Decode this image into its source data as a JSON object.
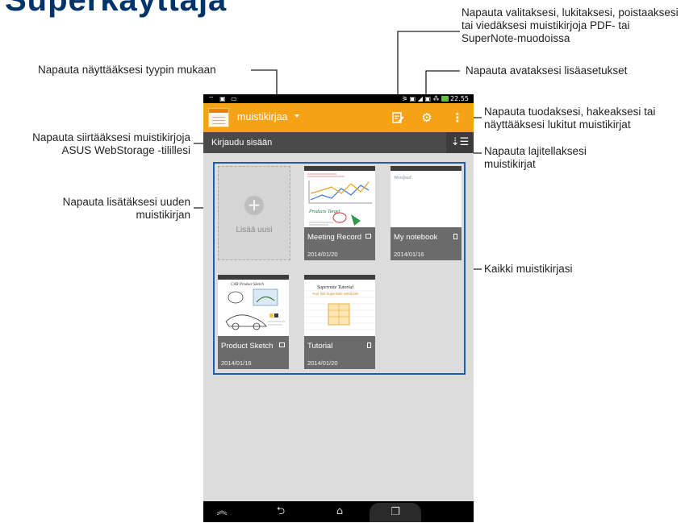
{
  "header_fragment": "Superkäyttäjä",
  "annotations": {
    "view_by_type": "Napauta näyttääksesi tyypin mukaan",
    "move_to_webstorage": "Napauta siirtääksesi muistikirjoja ASUS WebStorage -tilillesi",
    "add_new_notebook": "Napauta lisätäksesi uuden muistikirjan",
    "select_lock_delete_export": "Napauta valitaksesi, lukitaksesi, poistaaksesi tai viedäksesi muistikirjoja PDF- tai SuperNote-muodoissa",
    "open_settings": "Napauta avataksesi lisäasetukset",
    "import_search_locked": "Napauta tuodaksesi, hakeaksesi tai näyttääksesi lukitut muistikirjat",
    "sort_notebooks": "Napauta lajitellaksesi muistikirjat",
    "all_notebooks": "Kaikki muistikirjasi"
  },
  "status_bar": {
    "time": "22.55"
  },
  "app_bar": {
    "title": "muistikirjaa",
    "icons": [
      "edit-notebook-icon",
      "settings-gear-icon",
      "overflow-menu-icon"
    ]
  },
  "sub_bar": {
    "login_label": "Kirjaudu sisään",
    "sort_icon": "sort-icon"
  },
  "add_new": {
    "label": "Lisää uusi"
  },
  "notebooks": [
    {
      "name": "Meeting Record",
      "date": "2014/01/20",
      "page_icon": "landscape-page-icon"
    },
    {
      "name": "My notebook",
      "date": "2014/01/16",
      "page_icon": "portrait-page-icon"
    },
    {
      "name": "Product Sketch",
      "date": "2014/01/16",
      "page_icon": "landscape-page-icon"
    },
    {
      "name": "Tutorial",
      "date": "2014/01/20",
      "page_icon": "portrait-page-icon"
    }
  ],
  "thumb_text": {
    "my_notebook": "Wordpad",
    "meeting": "Products Target",
    "sketch": "CAR Product Sketch",
    "tutorial_title": "Supernote Tutorial",
    "tutorial_sub": "Your first SuperNote notebook!"
  },
  "nav_bar": {
    "icons": [
      "collapse-icon",
      "back-icon",
      "home-icon",
      "recent-apps-icon"
    ]
  }
}
